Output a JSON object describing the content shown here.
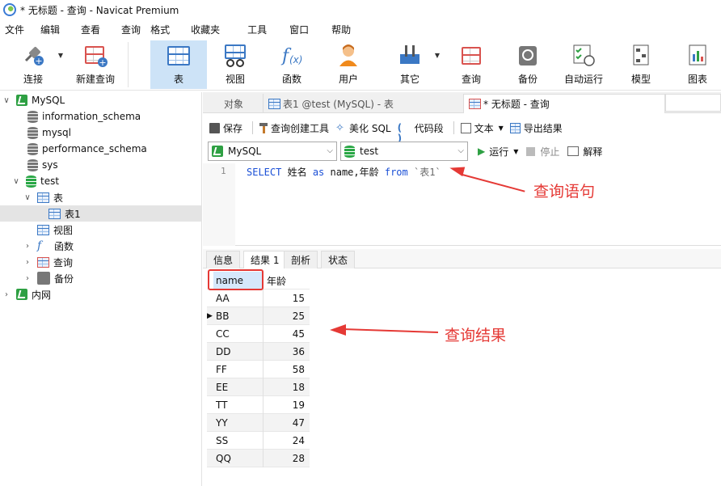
{
  "title": "* 无标题 - 查询 - Navicat Premium",
  "menu": [
    "文件",
    "编辑",
    "查看",
    "查询",
    "格式",
    "收藏夹",
    "工具",
    "窗口",
    "帮助"
  ],
  "toolbar": [
    {
      "label": "连接",
      "icon": "plug-icon"
    },
    {
      "label": "新建查询",
      "icon": "new-query-icon"
    },
    {
      "label": "表",
      "icon": "table-icon",
      "active": true
    },
    {
      "label": "视图",
      "icon": "view-icon"
    },
    {
      "label": "函数",
      "icon": "function-icon"
    },
    {
      "label": "用户",
      "icon": "user-icon"
    },
    {
      "label": "其它",
      "icon": "tools-icon"
    },
    {
      "label": "查询",
      "icon": "query-icon"
    },
    {
      "label": "备份",
      "icon": "backup-icon"
    },
    {
      "label": "自动运行",
      "icon": "schedule-icon"
    },
    {
      "label": "模型",
      "icon": "model-icon"
    },
    {
      "label": "图表",
      "icon": "chart-icon"
    }
  ],
  "tree": {
    "connection": "MySQL",
    "databases": [
      "information_schema",
      "mysql",
      "performance_schema",
      "sys",
      "test"
    ],
    "test_children": [
      "表",
      "视图",
      "函数",
      "查询",
      "备份"
    ],
    "table": "表1",
    "other_connection": "内网"
  },
  "tabs": [
    "对象",
    "表1 @test (MySQL) - 表",
    "* 无标题 - 查询"
  ],
  "query_toolbar": {
    "save": "保存",
    "builder": "查询创建工具",
    "beautify": "美化 SQL",
    "snippet": "代码段",
    "text": "文本",
    "export": "导出结果",
    "run": "运行",
    "stop": "停止",
    "explain": "解释"
  },
  "connection_select": "MySQL",
  "database_select": "test",
  "editor": {
    "line_number": "1",
    "select": "SELECT",
    "col1": " 姓名 ",
    "as": "as",
    "rest": " name,年龄 ",
    "from": "from",
    "table": " `表1`"
  },
  "result_tabs": [
    "信息",
    "结果 1",
    "剖析",
    "状态"
  ],
  "result": {
    "columns": [
      "name",
      "年龄"
    ],
    "rows": [
      [
        "AA",
        "15"
      ],
      [
        "BB",
        "25"
      ],
      [
        "CC",
        "45"
      ],
      [
        "DD",
        "36"
      ],
      [
        "FF",
        "58"
      ],
      [
        "EE",
        "18"
      ],
      [
        "TT",
        "19"
      ],
      [
        "YY",
        "47"
      ],
      [
        "SS",
        "24"
      ],
      [
        "QQ",
        "28"
      ]
    ]
  },
  "annotations": {
    "query": "查询语句",
    "result": "查询结果"
  },
  "colors": {
    "accent": "#e53935",
    "active_tool": "#cde3f7",
    "keyword": "#1a4fd6"
  }
}
